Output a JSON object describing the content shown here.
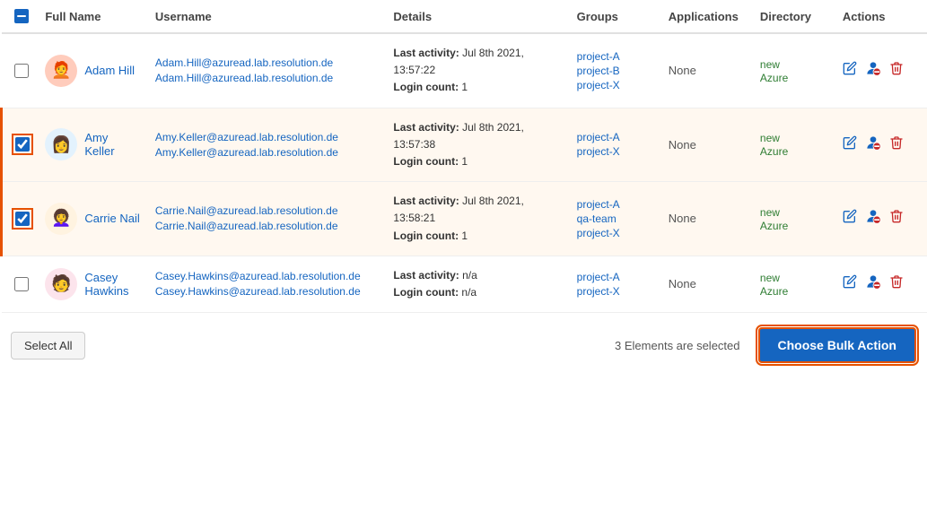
{
  "header": {
    "columns": [
      "Full Name",
      "Username",
      "Details",
      "Groups",
      "Applications",
      "Directory",
      "Actions"
    ]
  },
  "users": [
    {
      "id": "adam-hill",
      "name": "Adam Hill",
      "email": "Adam.Hill@azuread.lab.resolution.de",
      "avatar_emoji": "🧑‍🦰",
      "avatar_bg": "#ffccbc",
      "last_activity": "Jul 8th 2021, 13:57:22",
      "login_count": "1",
      "groups": [
        "project-A",
        "project-B",
        "project-X"
      ],
      "applications": "None",
      "directory_label": "new Azure",
      "checked": false
    },
    {
      "id": "amy-keller",
      "name": "Amy Keller",
      "email": "Amy.Keller@azuread.lab.resolution.de",
      "avatar_emoji": "👩",
      "avatar_bg": "#e3f2fd",
      "last_activity": "Jul 8th 2021, 13:57:38",
      "login_count": "1",
      "groups": [
        "project-A",
        "project-X"
      ],
      "applications": "None",
      "directory_label": "new Azure",
      "checked": true
    },
    {
      "id": "carrie-nail",
      "name": "Carrie Nail",
      "email": "Carrie.Nail@azuread.lab.resolution.de",
      "avatar_emoji": "👩‍🦱",
      "avatar_bg": "#fff3e0",
      "last_activity": "Jul 8th 2021, 13:58:21",
      "login_count": "1",
      "groups": [
        "project-A",
        "qa-team",
        "project-X"
      ],
      "applications": "None",
      "directory_label": "new Azure",
      "checked": true
    },
    {
      "id": "casey-hawkins",
      "name": "Casey Hawkins",
      "email": "Casey.Hawkins@azuread.lab.resolution.de",
      "avatar_emoji": "🧑",
      "avatar_bg": "#fce4ec",
      "last_activity": "n/a",
      "login_count": "n/a",
      "groups": [
        "project-A",
        "project-X"
      ],
      "applications": "None",
      "directory_label": "new Azure",
      "checked": false
    }
  ],
  "footer": {
    "select_all_label": "Select All",
    "elements_selected_text": "3 Elements are selected",
    "bulk_action_label": "Choose Bulk Action"
  },
  "labels": {
    "last_activity": "Last activity:",
    "login_count": "Login count:"
  }
}
